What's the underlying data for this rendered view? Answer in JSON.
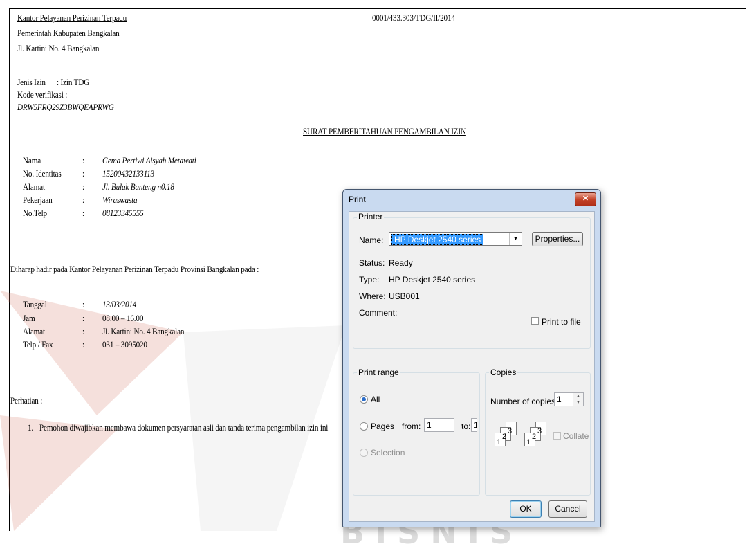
{
  "doc": {
    "office_name": "Kantor Pelayanan Perizinan Terpadu",
    "doc_number": "0001/433.303/TDG/II/2014",
    "government": "Pemerintah Kabupaten Bangkalan",
    "office_address": "Jl. Kartini No. 4 Bangkalan",
    "permit_type_label": "Jenis Izin",
    "permit_type_value": ": Izin TDG",
    "verification_label": "Kode verifikasi :",
    "verification_code": "DRW5FRQ29Z3BWQEAPRWG",
    "letter_title": "SURAT PEMBERITAHUAN PENGAMBILAN IZIN",
    "applicant": [
      {
        "label": "Nama",
        "value": "Gema Pertiwi Aisyah Metawati"
      },
      {
        "label": "No. Identitas",
        "value": "15200432133113"
      },
      {
        "label": "Alamat",
        "value": "Jl. Bulak Banteng n0.18"
      },
      {
        "label": "Pekerjaan",
        "value": "Wiraswasta"
      },
      {
        "label": "No.Telp",
        "value": "08123345555"
      }
    ],
    "invitation": "Diharap hadir  pada Kantor Pelayanan Perizinan Terpadu Provinsi Bangkalan pada :",
    "schedule": [
      {
        "label": "Tanggal",
        "value": "13/03/2014"
      },
      {
        "label": "Jam",
        "value": "08.00 – 16.00"
      },
      {
        "label": "Alamat",
        "value": "Jl. Kartini No. 4 Bangkalan"
      },
      {
        "label": "Telp / Fax",
        "value": "031 – 3095020"
      }
    ],
    "colon": ":",
    "notice_label": "Perhatian :",
    "notice_items": [
      {
        "num": "1.",
        "text": "Pemohon diwajibkan membawa dokumen persyaratan asli dan tanda terima pengambilan izin ini"
      }
    ]
  },
  "watermark": {
    "text": "INSTITUT BISNIS"
  },
  "print_dialog": {
    "title": "Print",
    "close_glyph": "✕",
    "printer_group": "Printer",
    "name_label": "Name:",
    "printer_name": "HP Deskjet 2540 series",
    "properties_button": "Properties...",
    "status_label": "Status:",
    "status_value": "Ready",
    "type_label": "Type:",
    "type_value": "HP Deskjet 2540 series",
    "where_label": "Where:",
    "where_value": "USB001",
    "comment_label": "Comment:",
    "print_to_file": "Print to file",
    "print_range_group": "Print range",
    "range_all": "All",
    "range_pages": "Pages",
    "from_label": "from:",
    "from_value": "1",
    "to_label": "to:",
    "to_value": "1",
    "range_selection": "Selection",
    "copies_group": "Copies",
    "copies_label": "Number of copies:",
    "copies_value": "1",
    "collate_label": "Collate",
    "ok_button": "OK",
    "cancel_button": "Cancel"
  }
}
